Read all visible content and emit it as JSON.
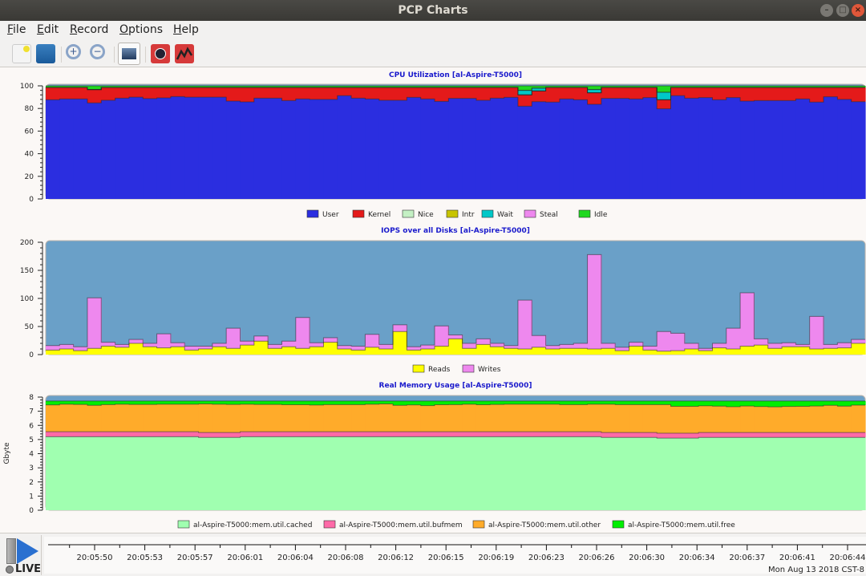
{
  "window": {
    "title": "PCP Charts"
  },
  "menu": [
    {
      "label": "File",
      "key": "F",
      "rest": "ile"
    },
    {
      "label": "Edit",
      "key": "E",
      "rest": "dit"
    },
    {
      "label": "Record",
      "key": "R",
      "rest": "ecord"
    },
    {
      "label": "Options",
      "key": "O",
      "rest": "ptions"
    },
    {
      "label": "Help",
      "key": "H",
      "rest": "elp"
    }
  ],
  "toolbar": [
    "new-chart-icon",
    "open-view-icon",
    "zoom-in-icon",
    "zoom-out-icon",
    "export-image-icon",
    "record-timer-icon",
    "chart-trend-icon"
  ],
  "timeline": {
    "live_label": "LIVE",
    "ticks": [
      "20:05:50",
      "20:05:53",
      "20:05:57",
      "20:06:01",
      "20:06:04",
      "20:06:08",
      "20:06:12",
      "20:06:15",
      "20:06:19",
      "20:06:23",
      "20:06:26",
      "20:06:30",
      "20:06:34",
      "20:06:37",
      "20:06:41",
      "20:06:44"
    ],
    "date": "Mon Aug 13 2018 CST-8"
  },
  "chart_data": [
    {
      "type": "area",
      "title": "CPU Utilization [al-Aspire-T5000]",
      "ylabel": "",
      "ylim": [
        0,
        100
      ],
      "yticks": [
        "0",
        "20",
        "40",
        "60",
        "80",
        "100"
      ],
      "plot_bg": "#6aa0c8",
      "series": [
        {
          "name": "User",
          "color": "#2b2ee0",
          "values": [
            87.7,
            88.4,
            88.4,
            84.9,
            87.2,
            89.1,
            90,
            88.7,
            89.4,
            90.5,
            90,
            90,
            90,
            86.5,
            85.8,
            89.1,
            89.1,
            87,
            88.4,
            88,
            88,
            91.3,
            89.1,
            88.4,
            87.2,
            87.2,
            89.8,
            88.4,
            86.3,
            88.9,
            88.9,
            87.2,
            89.1,
            89.8,
            82,
            86,
            85.6,
            88.4,
            87.7,
            83.7,
            88.9,
            88.9,
            88.4,
            89.6,
            79.7,
            91.3,
            89.1,
            89.6,
            87.7,
            89.6,
            86.5,
            87,
            87,
            87,
            88.4,
            85.6,
            90.3,
            88,
            86
          ]
        },
        {
          "name": "Kernel",
          "color": "#e41a1a",
          "values": [
            10.9,
            10.2,
            10.2,
            11.8,
            11.4,
            9.5,
            8.6,
            9.9,
            9.2,
            8.1,
            8.6,
            8.6,
            8.6,
            12.1,
            12.8,
            9.5,
            9.5,
            11.6,
            10.2,
            10.6,
            10.6,
            7.3,
            9.5,
            10.2,
            11.4,
            11.4,
            8.8,
            10.2,
            12.3,
            9.7,
            9.7,
            11.4,
            9.5,
            8.8,
            10,
            9.5,
            13,
            10.2,
            10.9,
            10.2,
            9.7,
            9.7,
            10.2,
            9,
            8,
            7.3,
            9.5,
            9,
            10.9,
            9,
            12.1,
            11.6,
            11.6,
            11.6,
            10.2,
            13,
            8.3,
            10.6,
            12.6
          ]
        },
        {
          "name": "Nice",
          "color": "#c4f0c4",
          "values": [
            0,
            0,
            0,
            0,
            0,
            0,
            0,
            0,
            0,
            0,
            0,
            0,
            0,
            0,
            0,
            0,
            0,
            0,
            0,
            0,
            0,
            0,
            0,
            0,
            0,
            0,
            0,
            0,
            0,
            0,
            0,
            0,
            0,
            0,
            0,
            0,
            0,
            0,
            0,
            0,
            0,
            0,
            0,
            0,
            0,
            0,
            0,
            0,
            0,
            0,
            0,
            0,
            0,
            0,
            0,
            0,
            0,
            0,
            0
          ]
        },
        {
          "name": "Intr",
          "color": "#c8c400",
          "values": [
            0,
            0,
            0,
            0,
            0,
            0,
            0,
            0,
            0,
            0,
            0,
            0,
            0,
            0,
            0,
            0,
            0,
            0,
            0,
            0,
            0,
            0,
            0,
            0,
            0,
            0,
            0,
            0,
            0,
            0,
            0,
            0,
            0,
            0,
            0,
            0,
            0,
            0,
            0,
            0,
            0,
            0,
            0,
            0,
            0,
            0,
            0,
            0,
            0,
            0,
            0,
            0,
            0,
            0,
            0,
            0,
            0,
            0,
            0
          ]
        },
        {
          "name": "Wait",
          "color": "#00c8c8",
          "values": [
            0,
            0,
            0,
            0,
            0,
            0,
            0,
            0,
            0,
            0,
            0,
            0,
            0,
            0,
            0,
            0,
            0,
            0,
            0,
            0,
            0,
            0,
            0,
            0,
            0,
            0,
            0,
            0,
            0,
            0,
            0,
            0,
            0,
            0,
            4,
            2.5,
            0,
            0,
            0,
            2.8,
            0,
            0,
            0,
            0,
            6.6,
            0,
            0,
            0,
            0,
            0,
            0,
            0,
            0,
            0,
            0,
            0,
            0,
            0,
            0
          ]
        },
        {
          "name": "Steal",
          "color": "#ee88ee",
          "values": [
            0,
            0,
            0,
            0,
            0,
            0,
            0,
            0,
            0,
            0,
            0,
            0,
            0,
            0,
            0,
            0,
            0,
            0,
            0,
            0,
            0,
            0,
            0,
            0,
            0,
            0,
            0,
            0,
            0,
            0,
            0,
            0,
            0,
            0,
            0,
            0,
            0,
            0,
            0,
            0,
            0,
            0,
            0,
            0,
            0,
            0,
            0,
            0,
            0,
            0,
            0,
            0,
            0,
            0,
            0,
            0,
            0,
            0,
            0
          ]
        },
        {
          "name": "Idle",
          "color": "#1fd81f",
          "values": [
            1.4,
            1.4,
            1.4,
            3.3,
            1.4,
            1.4,
            1.4,
            1.4,
            1.4,
            1.4,
            1.4,
            1.4,
            1.4,
            1.4,
            1.4,
            1.4,
            1.4,
            1.4,
            1.4,
            1.4,
            1.4,
            1.4,
            1.4,
            1.4,
            1.4,
            1.4,
            1.4,
            1.4,
            1.4,
            1.4,
            1.4,
            1.4,
            1.4,
            1.4,
            4,
            2,
            1.4,
            1.4,
            1.4,
            3.3,
            1.4,
            1.4,
            1.4,
            1.4,
            5.7,
            1.4,
            1.4,
            1.4,
            1.4,
            1.4,
            1.4,
            1.4,
            1.4,
            1.4,
            1.4,
            1.4,
            1.4,
            1.4,
            1.4
          ]
        }
      ]
    },
    {
      "type": "area",
      "title": "IOPS over all Disks [al-Aspire-T5000]",
      "ylabel": "",
      "ylim": [
        0,
        200
      ],
      "yticks": [
        "0",
        "50",
        "100",
        "150",
        "200"
      ],
      "plot_bg": "#6aa0c8",
      "series": [
        {
          "name": "Reads",
          "color": "#ffff00",
          "values": [
            8,
            10,
            7,
            11,
            15,
            13,
            20,
            14,
            12,
            14,
            8,
            10,
            14,
            11,
            17,
            24,
            11,
            14,
            11,
            14,
            22,
            10,
            8,
            13,
            10,
            41,
            8,
            10,
            15,
            28,
            11,
            18,
            14,
            11,
            10,
            13,
            10,
            11,
            11,
            10,
            11,
            7,
            15,
            8,
            6,
            7,
            10,
            7,
            12,
            10,
            15,
            17,
            11,
            14,
            14,
            10,
            11,
            12,
            20
          ]
        },
        {
          "name": "Writes",
          "color": "#ee88ee",
          "values": [
            8,
            8,
            7,
            90,
            7,
            5,
            7,
            6,
            25,
            7,
            7,
            5,
            6,
            36,
            7,
            9,
            7,
            10,
            55,
            7,
            8,
            6,
            7,
            23,
            8,
            12,
            6,
            7,
            36,
            7,
            9,
            10,
            6,
            5,
            87,
            21,
            6,
            7,
            9,
            168,
            9,
            6,
            7,
            7,
            35,
            31,
            10,
            4,
            8,
            37,
            95,
            11,
            9,
            7,
            4,
            58,
            7,
            9,
            7
          ]
        }
      ]
    },
    {
      "type": "area",
      "title": "Real Memory Usage [al-Aspire-T5000]",
      "ylabel": "Gbyte",
      "ylim": [
        0,
        8.1
      ],
      "yticks": [
        "0",
        "1",
        "2",
        "3",
        "4",
        "5",
        "6",
        "7",
        "8"
      ],
      "plot_bg": "#6aa0c8",
      "series": [
        {
          "name": "al-Aspire-T5000:mem.util.cached",
          "color": "#a0ffb0",
          "values": [
            5.2,
            5.2,
            5.2,
            5.2,
            5.2,
            5.2,
            5.2,
            5.2,
            5.2,
            5.2,
            5.2,
            5.15,
            5.15,
            5.15,
            5.2,
            5.2,
            5.2,
            5.2,
            5.2,
            5.2,
            5.2,
            5.2,
            5.2,
            5.2,
            5.2,
            5.2,
            5.2,
            5.2,
            5.2,
            5.2,
            5.2,
            5.2,
            5.2,
            5.2,
            5.2,
            5.2,
            5.2,
            5.2,
            5.2,
            5.2,
            5.15,
            5.15,
            5.15,
            5.15,
            5.1,
            5.1,
            5.1,
            5.15,
            5.15,
            5.15,
            5.15,
            5.15,
            5.15,
            5.15,
            5.15,
            5.15,
            5.15,
            5.15,
            5.15
          ]
        },
        {
          "name": "al-Aspire-T5000:mem.util.bufmem",
          "color": "#ff6aa8",
          "values": [
            0.35,
            0.35,
            0.35,
            0.35,
            0.35,
            0.35,
            0.35,
            0.35,
            0.35,
            0.35,
            0.35,
            0.35,
            0.35,
            0.35,
            0.35,
            0.35,
            0.35,
            0.35,
            0.35,
            0.35,
            0.35,
            0.35,
            0.35,
            0.35,
            0.35,
            0.35,
            0.35,
            0.35,
            0.35,
            0.35,
            0.35,
            0.35,
            0.35,
            0.35,
            0.35,
            0.35,
            0.35,
            0.35,
            0.35,
            0.35,
            0.35,
            0.35,
            0.35,
            0.35,
            0.35,
            0.35,
            0.35,
            0.35,
            0.35,
            0.35,
            0.35,
            0.35,
            0.35,
            0.35,
            0.35,
            0.35,
            0.35,
            0.35,
            0.35
          ]
        },
        {
          "name": "al-Aspire-T5000:mem.util.other",
          "color": "#ffab2a",
          "values": [
            1.9,
            1.95,
            1.93,
            1.87,
            1.92,
            1.95,
            1.93,
            1.93,
            1.95,
            1.95,
            1.95,
            2.02,
            2.0,
            1.98,
            1.95,
            1.93,
            1.93,
            1.91,
            1.91,
            1.89,
            1.92,
            1.92,
            1.92,
            1.95,
            1.97,
            1.87,
            1.9,
            1.85,
            1.91,
            1.92,
            1.95,
            1.91,
            1.93,
            1.95,
            1.95,
            1.95,
            1.95,
            1.92,
            1.92,
            1.95,
            2.0,
            1.97,
            1.97,
            1.97,
            2.02,
            1.9,
            1.9,
            1.88,
            1.86,
            1.82,
            1.87,
            1.83,
            1.81,
            1.84,
            1.85,
            1.87,
            1.92,
            1.86,
            1.93
          ]
        },
        {
          "name": "al-Aspire-T5000:mem.util.free",
          "color": "#00ee00",
          "values": [
            0.27,
            0.22,
            0.24,
            0.3,
            0.25,
            0.22,
            0.24,
            0.24,
            0.22,
            0.22,
            0.22,
            0.2,
            0.22,
            0.24,
            0.22,
            0.24,
            0.24,
            0.26,
            0.26,
            0.28,
            0.25,
            0.25,
            0.25,
            0.22,
            0.2,
            0.3,
            0.27,
            0.32,
            0.26,
            0.25,
            0.22,
            0.26,
            0.24,
            0.22,
            0.22,
            0.22,
            0.22,
            0.25,
            0.25,
            0.22,
            0.22,
            0.25,
            0.25,
            0.25,
            0.25,
            0.37,
            0.37,
            0.34,
            0.36,
            0.4,
            0.35,
            0.39,
            0.41,
            0.38,
            0.37,
            0.35,
            0.3,
            0.36,
            0.29
          ]
        }
      ]
    }
  ]
}
